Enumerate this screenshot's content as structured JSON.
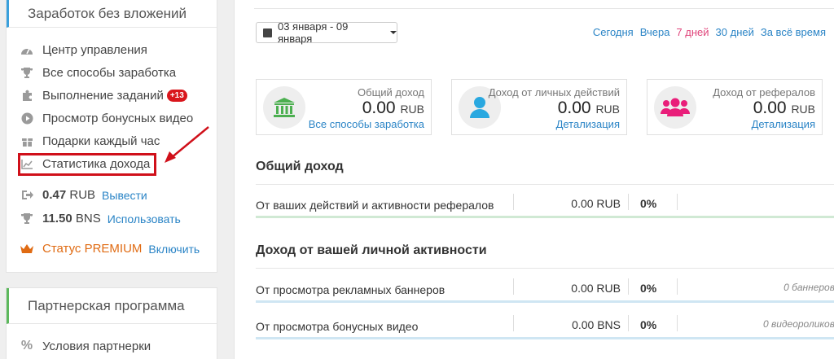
{
  "sidebar": {
    "panel1_title": "Заработок без вложений",
    "items": [
      {
        "label": "Центр управления",
        "icon": "dashboard-icon",
        "glyph": "◔"
      },
      {
        "label": "Все способы заработка",
        "icon": "trophy-icon",
        "glyph": "🏆"
      },
      {
        "label": "Выполнение заданий",
        "icon": "puzzle-icon",
        "glyph": "✚",
        "badge": "+13"
      },
      {
        "label": "Просмотр бонусных видео",
        "icon": "play-icon",
        "glyph": "▶"
      },
      {
        "label": "Подарки каждый час",
        "icon": "gift-icon",
        "glyph": "▣"
      },
      {
        "label": "Статистика дохода",
        "icon": "chart-icon",
        "glyph": "⟋"
      }
    ],
    "balance_rub": {
      "value": "0.47",
      "unit": "RUB",
      "action": "Вывести"
    },
    "balance_bns": {
      "value": "11.50",
      "unit": "BNS",
      "action": "Использовать"
    },
    "premium": {
      "label": "Статус PREMIUM",
      "action": "Включить"
    },
    "panel2_title": "Партнерская программа",
    "panel2_items": [
      {
        "label": "Условия партнерки",
        "icon": "percent-icon",
        "glyph": "%"
      }
    ]
  },
  "filter": {
    "date_range": "03 января - 09 января",
    "periods": [
      {
        "label": "Сегодня",
        "active": false
      },
      {
        "label": "Вчера",
        "active": false
      },
      {
        "label": "7 дней",
        "active": true
      },
      {
        "label": "30 дней",
        "active": false
      },
      {
        "label": "За всё время",
        "active": false
      }
    ]
  },
  "cards": [
    {
      "title": "Общий доход",
      "amount": "0.00",
      "unit": "RUB",
      "link": "Все способы заработка",
      "icon": "bank-icon",
      "color": "#4caf50"
    },
    {
      "title": "Доход от личных действий",
      "amount": "0.00",
      "unit": "RUB",
      "link": "Детализация",
      "icon": "user-icon",
      "color": "#29a8e0"
    },
    {
      "title": "Доход от рефералов",
      "amount": "0.00",
      "unit": "RUB",
      "link": "Детализация",
      "icon": "users-icon",
      "color": "#e91e7a"
    }
  ],
  "sections": {
    "total_title": "Общий доход",
    "total_row": {
      "label": "От ваших действий и активности рефералов",
      "amount": "0.00 RUB",
      "percent": "0%"
    },
    "personal_title": "Доход от вашей личной активности",
    "personal_rows": [
      {
        "label": "От просмотра рекламных баннеров",
        "amount": "0.00 RUB",
        "percent": "0%",
        "note": "0 баннеров"
      },
      {
        "label": "От просмотра бонусных видео",
        "amount": "0.00 BNS",
        "percent": "0%",
        "note": "0 видеороликов"
      }
    ]
  },
  "colors": {
    "accent_blue": "#2a84c6",
    "active_period": "#e0457b",
    "highlight": "#d0101a",
    "premium": "#e06b13"
  }
}
